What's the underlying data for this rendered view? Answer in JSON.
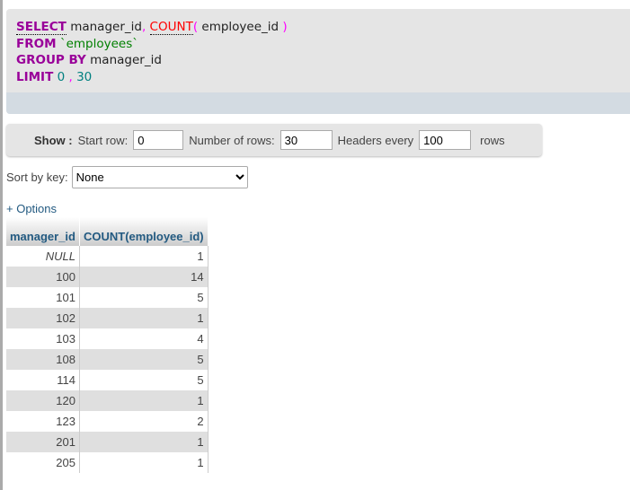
{
  "sql": {
    "select": "SELECT",
    "col1": "manager_id",
    "comma": ",",
    "count": "COUNT",
    "lp": "(",
    "arg": "employee_id",
    "rp": ")",
    "from": "FROM",
    "table": "`employees`",
    "groupby": "GROUP BY",
    "groupcol": "manager_id",
    "limit": "LIMIT",
    "offset": "0",
    "sep": ",",
    "rows": "30"
  },
  "nav": {
    "show": "Show :",
    "start_label": "Start row:",
    "start_value": "0",
    "num_label": "Number of rows:",
    "num_value": "30",
    "headers_label": "Headers every",
    "headers_value": "100",
    "rows_label": "rows"
  },
  "sort": {
    "label": "Sort by key:",
    "value": "None"
  },
  "options": "+ Options",
  "table": {
    "headers": [
      "manager_id",
      "COUNT(employee_id)"
    ],
    "rows": [
      [
        "NULL",
        "1"
      ],
      [
        "100",
        "14"
      ],
      [
        "101",
        "5"
      ],
      [
        "102",
        "1"
      ],
      [
        "103",
        "4"
      ],
      [
        "108",
        "5"
      ],
      [
        "114",
        "5"
      ],
      [
        "120",
        "1"
      ],
      [
        "123",
        "2"
      ],
      [
        "201",
        "1"
      ],
      [
        "205",
        "1"
      ]
    ]
  }
}
